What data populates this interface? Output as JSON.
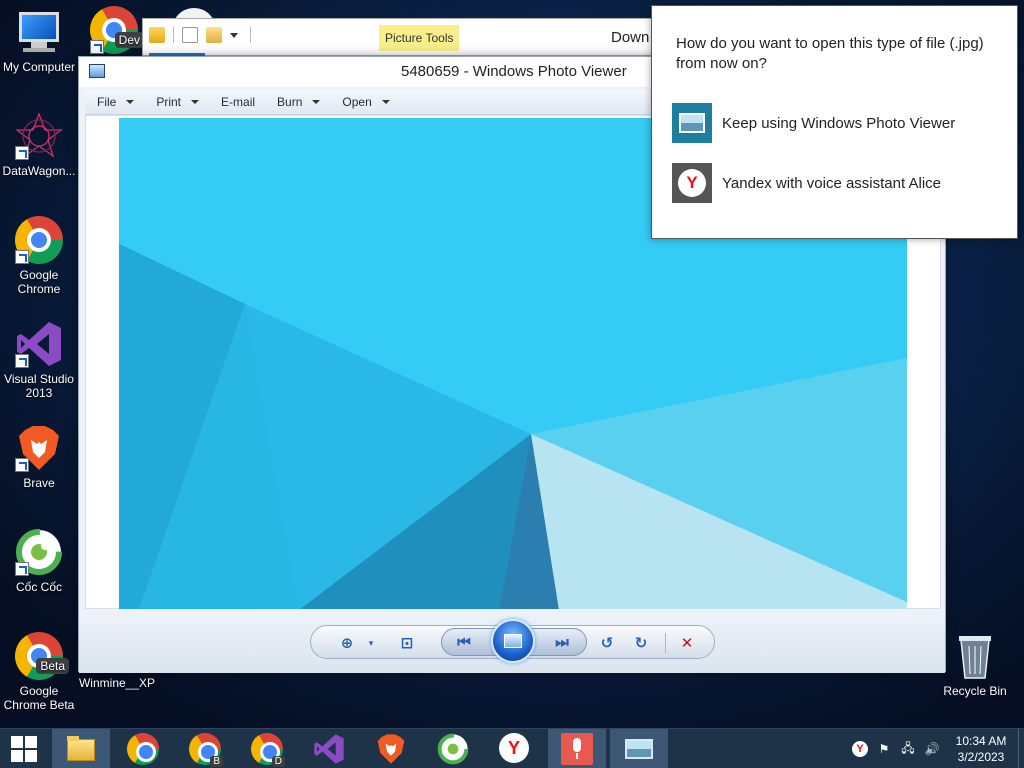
{
  "desktop": {
    "icons": [
      {
        "label": "My Computer",
        "icon": "computer-icon"
      },
      {
        "label": "DataWagon...",
        "icon": "datawagon-icon"
      },
      {
        "label": "Google\nChrome",
        "icon": "chrome-icon"
      },
      {
        "label": "Visual Studio\n2013",
        "icon": "visual-studio-icon"
      },
      {
        "label": "Brave",
        "icon": "brave-icon"
      },
      {
        "label": "Cốc Cốc",
        "icon": "coccoc-icon"
      },
      {
        "label": "Google\nChrome Beta",
        "icon": "chrome-beta-icon"
      },
      {
        "label": "Winmine__XP",
        "icon": "winmine-icon"
      },
      {
        "label": "Recycle Bin",
        "icon": "recycle-bin-icon"
      }
    ],
    "chrome_dev_badge": "Dev",
    "chrome_beta_badge": "Beta"
  },
  "explorer": {
    "picture_tools_label": "Picture Tools",
    "title_fragment": "Down"
  },
  "photo_viewer": {
    "title": "5480659 - Windows Photo Viewer",
    "menu": [
      {
        "label": "File",
        "has_dropdown": true
      },
      {
        "label": "Print",
        "has_dropdown": true
      },
      {
        "label": "E-mail",
        "has_dropdown": false
      },
      {
        "label": "Burn",
        "has_dropdown": true
      },
      {
        "label": "Open",
        "has_dropdown": true
      }
    ]
  },
  "open_with": {
    "question": "How do you want to open this type of file (.jpg) from now on?",
    "options": [
      {
        "label": "Keep using Windows Photo Viewer",
        "icon": "photo-viewer-icon"
      },
      {
        "label": "Yandex with voice assistant Alice",
        "icon": "yandex-icon"
      }
    ]
  },
  "taskbar": {
    "apps": [
      {
        "name": "file-explorer",
        "active": true
      },
      {
        "name": "chrome",
        "active": false
      },
      {
        "name": "chrome-beta",
        "badge": "B",
        "active": false
      },
      {
        "name": "chrome-dev",
        "badge": "D",
        "active": false
      },
      {
        "name": "visual-studio",
        "active": false
      },
      {
        "name": "brave",
        "active": false
      },
      {
        "name": "coccoc",
        "active": false
      },
      {
        "name": "yandex",
        "active": false
      },
      {
        "name": "voice-assistant",
        "active": true
      },
      {
        "name": "photo-viewer",
        "active": true
      }
    ],
    "clock": {
      "time": "10:34 AM",
      "date": "3/2/2023"
    }
  },
  "colors": {
    "taskbar": "#1e3347",
    "photo_sky": "#2fc6f2",
    "accent": "#1979ca",
    "picture_tools": "#f8ee8a"
  }
}
